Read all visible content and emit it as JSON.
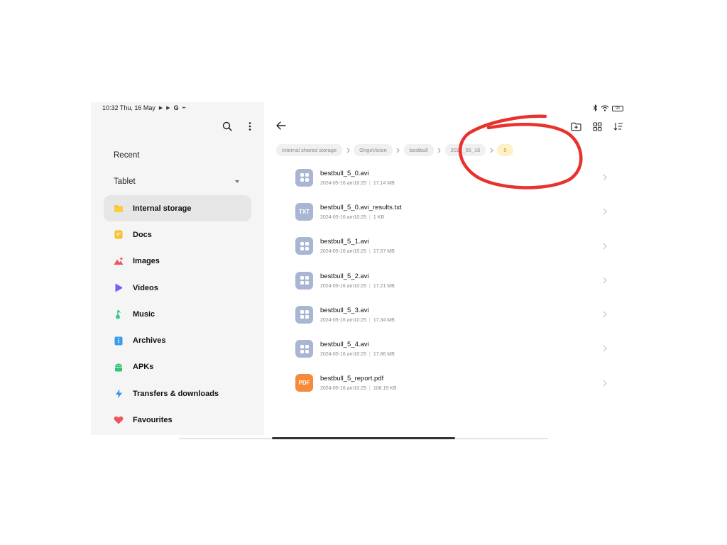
{
  "status_bar": {
    "time_date": "10:32 Thu, 16 May",
    "battery": "93"
  },
  "sidebar": {
    "recent_label": "Recent",
    "tablet_label": "Tablet",
    "items": [
      {
        "label": "Internal storage",
        "icon": "folder-icon",
        "color": "#f9c02d",
        "active": true
      },
      {
        "label": "Docs",
        "icon": "document-icon",
        "color": "#f9c02d"
      },
      {
        "label": "Images",
        "icon": "image-icon",
        "color": "#f0545c"
      },
      {
        "label": "Videos",
        "icon": "play-icon",
        "color": "#7b5cf5"
      },
      {
        "label": "Music",
        "icon": "music-icon",
        "color": "#3ec98a"
      },
      {
        "label": "Archives",
        "icon": "archive-icon",
        "color": "#3b9ce8"
      },
      {
        "label": "APKs",
        "icon": "android-icon",
        "color": "#36c27a"
      },
      {
        "label": "Transfers & downloads",
        "icon": "lightning-icon",
        "color": "#3b8ef0"
      },
      {
        "label": "Favourites",
        "icon": "heart-icon",
        "color": "#f0545c"
      }
    ]
  },
  "breadcrumb": [
    {
      "label": "Internal shared storage"
    },
    {
      "label": "OngoVision"
    },
    {
      "label": "bestbull"
    },
    {
      "label": "2024_05_16"
    },
    {
      "label": "5",
      "current": true
    }
  ],
  "files": [
    {
      "name": "bestbull_5_0.avi",
      "date": "2024-05-16 am10:25",
      "size": "17.14 MB",
      "type": "video"
    },
    {
      "name": "bestbull_5_0.avi_results.txt",
      "date": "2024-05-16 am10:25",
      "size": "1 KB",
      "type": "txt",
      "badge": "TXT"
    },
    {
      "name": "bestbull_5_1.avi",
      "date": "2024-05-16 am10:25",
      "size": "17.57 MB",
      "type": "video"
    },
    {
      "name": "bestbull_5_2.avi",
      "date": "2024-05-16 am10:25",
      "size": "17.21 MB",
      "type": "video"
    },
    {
      "name": "bestbull_5_3.avi",
      "date": "2024-05-16 am10:25",
      "size": "17.34 MB",
      "type": "video"
    },
    {
      "name": "bestbull_5_4.avi",
      "date": "2024-05-16 am10:25",
      "size": "17.86 MB",
      "type": "video"
    },
    {
      "name": "bestbull_5_report.pdf",
      "date": "2024-05-16 am10:25",
      "size": "108.19 KB",
      "type": "pdf",
      "badge": "PDF"
    }
  ],
  "colors": {
    "annotation": "#e8322e",
    "sidebar_bg": "#f5f5f5",
    "active_item_bg": "#e6e6e6",
    "current_crumb_bg": "#fdf1c8",
    "current_crumb_text": "#d39a14"
  }
}
